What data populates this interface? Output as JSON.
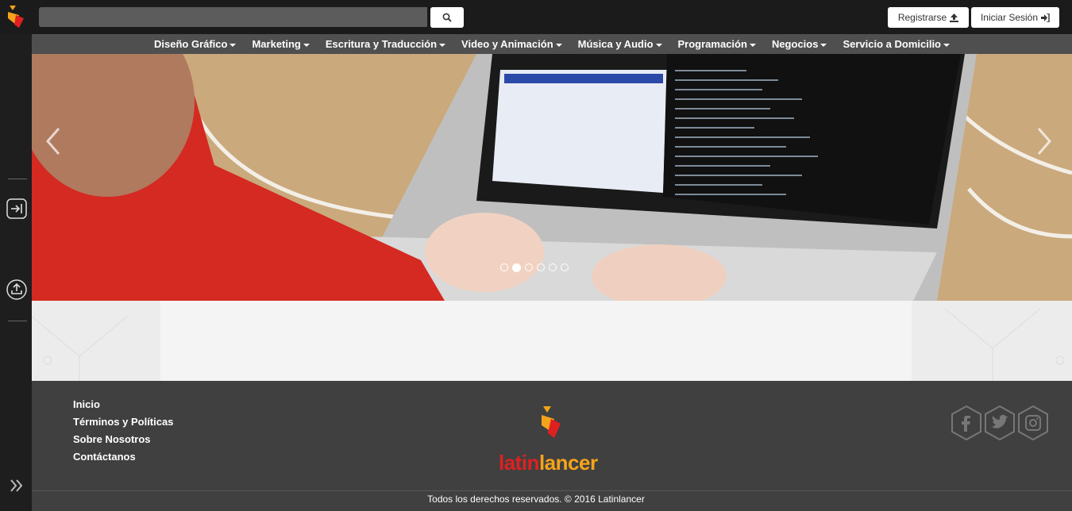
{
  "header": {
    "search_placeholder": "",
    "register_label": "Registrarse",
    "login_label": "Iniciar Sesión"
  },
  "nav": {
    "items": [
      {
        "label": "Diseño Gráfico"
      },
      {
        "label": "Marketing"
      },
      {
        "label": "Escritura y Traducción"
      },
      {
        "label": "Video y Animación"
      },
      {
        "label": "Música y Audio"
      },
      {
        "label": "Programación"
      },
      {
        "label": "Negocios"
      },
      {
        "label": "Servicio a Domicilio"
      }
    ]
  },
  "carousel": {
    "slide_count": 6,
    "active_index": 1
  },
  "footer": {
    "links": [
      "Inicio",
      "Términos y Políticas",
      "Sobre Nosotros",
      "Contáctanos"
    ],
    "brand_part1": "latin",
    "brand_part2": "lancer",
    "social": [
      "facebook-icon",
      "twitter-icon",
      "instagram-icon"
    ],
    "copyright": "Todos los derechos reservados. © 2016 Latinlancer"
  },
  "colors": {
    "brand_red": "#e02020",
    "brand_orange": "#f5a31a",
    "dark_bar": "#1b1b1b",
    "footer_bg": "#404040"
  }
}
